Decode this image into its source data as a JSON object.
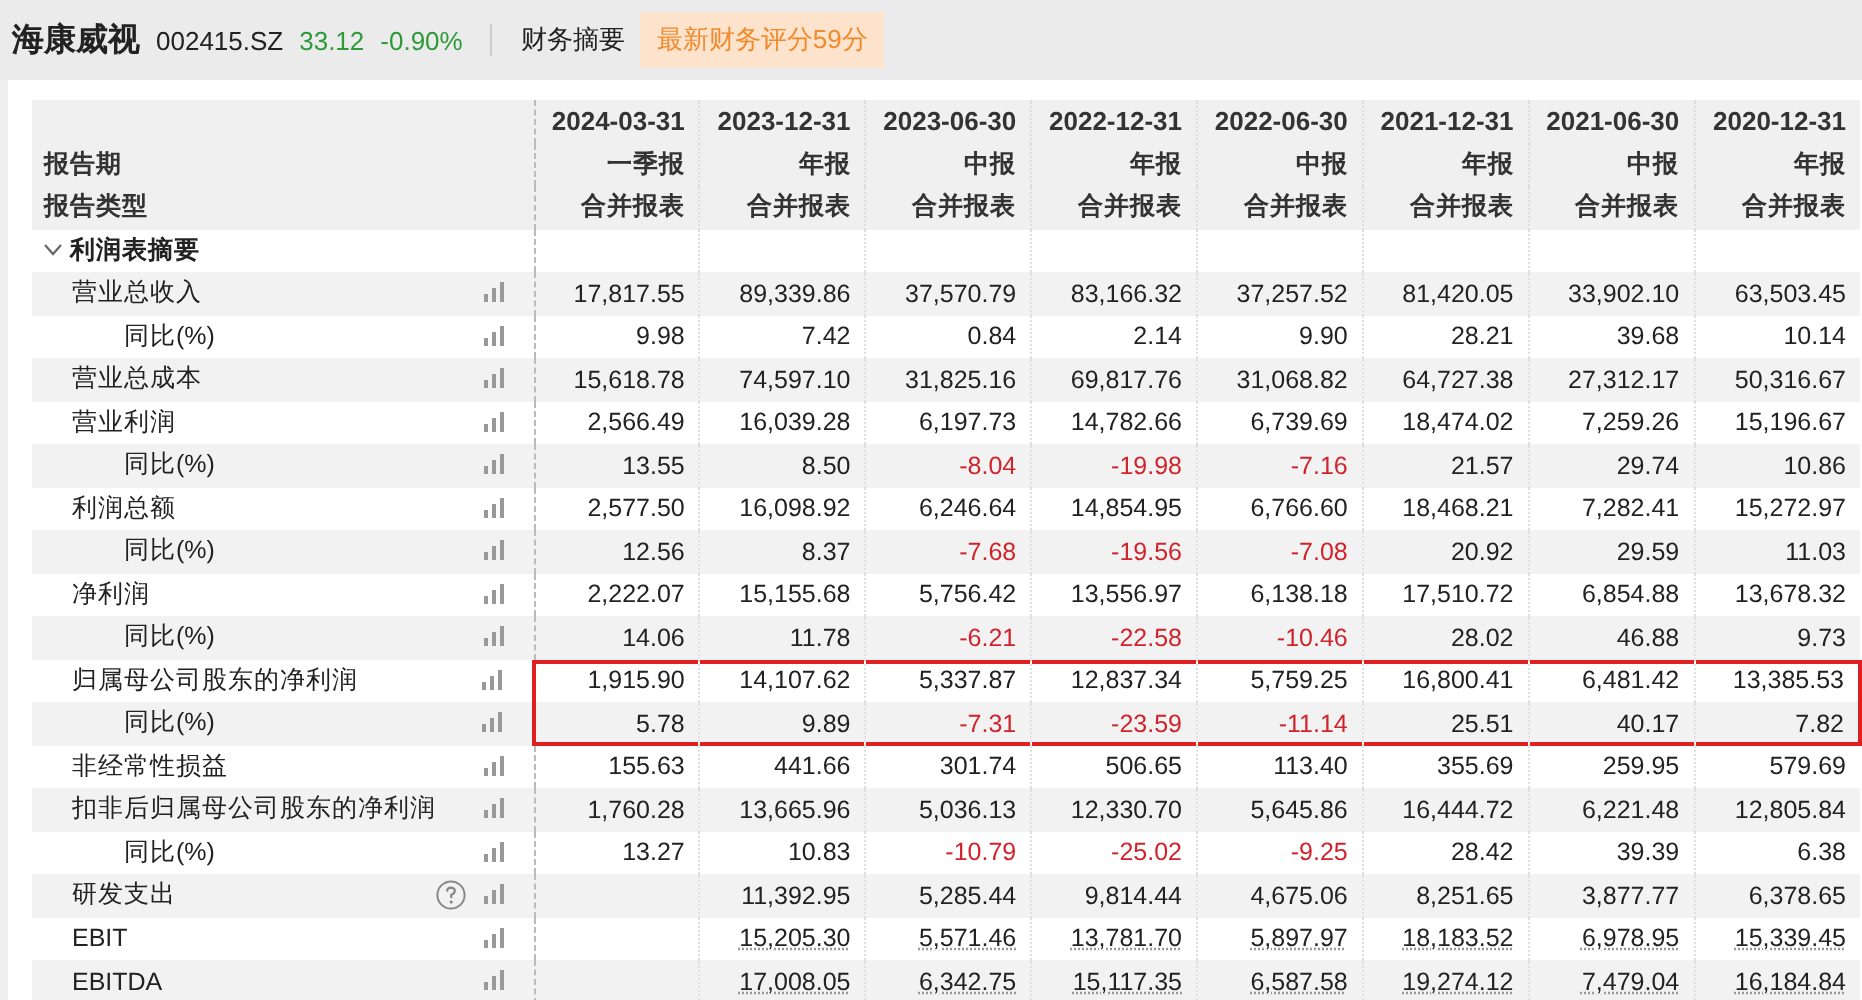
{
  "header": {
    "company": "海康威视",
    "code": "002415.SZ",
    "price": "33.12",
    "change": "-0.90%",
    "falling": true,
    "section": "财务摘要",
    "score_badge": "最新财务评分59分"
  },
  "table": {
    "period_label": "报告期",
    "type_label": "报告类型",
    "columns": [
      {
        "date": "2024-03-31",
        "period": "一季报",
        "type": "合并报表"
      },
      {
        "date": "2023-12-31",
        "period": "年报",
        "type": "合并报表"
      },
      {
        "date": "2023-06-30",
        "period": "中报",
        "type": "合并报表"
      },
      {
        "date": "2022-12-31",
        "period": "年报",
        "type": "合并报表"
      },
      {
        "date": "2022-06-30",
        "period": "中报",
        "type": "合并报表"
      },
      {
        "date": "2021-12-31",
        "period": "年报",
        "type": "合并报表"
      },
      {
        "date": "2021-06-30",
        "period": "中报",
        "type": "合并报表"
      },
      {
        "date": "2020-12-31",
        "period": "年报",
        "type": "合并报表"
      }
    ],
    "section": {
      "label": "利润表摘要",
      "expanded": true,
      "rows": [
        {
          "label": "营业总收入",
          "cells": [
            "17,817.55",
            "89,339.86",
            "37,570.79",
            "83,166.32",
            "37,257.52",
            "81,420.05",
            "33,902.10",
            "63,503.45"
          ],
          "children": [
            {
              "label": "同比(%)",
              "cells": [
                "9.98",
                "7.42",
                "0.84",
                "2.14",
                "9.90",
                "28.21",
                "39.68",
                "10.14"
              ]
            }
          ]
        },
        {
          "label": "营业总成本",
          "cells": [
            "15,618.78",
            "74,597.10",
            "31,825.16",
            "69,817.76",
            "31,068.82",
            "64,727.38",
            "27,312.17",
            "50,316.67"
          ]
        },
        {
          "label": "营业利润",
          "cells": [
            "2,566.49",
            "16,039.28",
            "6,197.73",
            "14,782.66",
            "6,739.69",
            "18,474.02",
            "7,259.26",
            "15,196.67"
          ],
          "children": [
            {
              "label": "同比(%)",
              "cells": [
                "13.55",
                "8.50",
                {
                  "text": "-8.04",
                  "negative": true
                },
                {
                  "text": "-19.98",
                  "negative": true
                },
                {
                  "text": "-7.16",
                  "negative": true
                },
                "21.57",
                "29.74",
                "10.86"
              ]
            }
          ]
        },
        {
          "label": "利润总额",
          "cells": [
            "2,577.50",
            "16,098.92",
            "6,246.64",
            "14,854.95",
            "6,766.60",
            "18,468.21",
            "7,282.41",
            "15,272.97"
          ],
          "children": [
            {
              "label": "同比(%)",
              "cells": [
                "12.56",
                "8.37",
                {
                  "text": "-7.68",
                  "negative": true
                },
                {
                  "text": "-19.56",
                  "negative": true
                },
                {
                  "text": "-7.08",
                  "negative": true
                },
                "20.92",
                "29.59",
                "11.03"
              ]
            }
          ]
        },
        {
          "label": "净利润",
          "cells": [
            "2,222.07",
            "15,155.68",
            "5,756.42",
            "13,556.97",
            "6,138.18",
            "17,510.72",
            "6,854.88",
            "13,678.32"
          ],
          "children": [
            {
              "label": "同比(%)",
              "cells": [
                "14.06",
                "11.78",
                {
                  "text": "-6.21",
                  "negative": true
                },
                {
                  "text": "-22.58",
                  "negative": true
                },
                {
                  "text": "-10.46",
                  "negative": true
                },
                "28.02",
                "46.88",
                "9.73"
              ]
            }
          ]
        },
        {
          "label": "归属母公司股东的净利润",
          "highlighted": true,
          "cells": [
            "1,915.90",
            "14,107.62",
            "5,337.87",
            "12,837.34",
            "5,759.25",
            "16,800.41",
            "6,481.42",
            "13,385.53"
          ],
          "children": [
            {
              "label": "同比(%)",
              "highlighted": true,
              "cells": [
                "5.78",
                "9.89",
                {
                  "text": "-7.31",
                  "negative": true
                },
                {
                  "text": "-23.59",
                  "negative": true
                },
                {
                  "text": "-11.14",
                  "negative": true
                },
                "25.51",
                "40.17",
                "7.82"
              ]
            }
          ]
        },
        {
          "label": "非经常性损益",
          "cells": [
            "155.63",
            "441.66",
            "301.74",
            "506.65",
            "113.40",
            "355.69",
            "259.95",
            "579.69"
          ]
        },
        {
          "label": "扣非后归属母公司股东的净利润",
          "cells": [
            "1,760.28",
            "13,665.96",
            "5,036.13",
            "12,330.70",
            "5,645.86",
            "16,444.72",
            "6,221.48",
            "12,805.84"
          ],
          "children": [
            {
              "label": "同比(%)",
              "cells": [
                "13.27",
                "10.83",
                {
                  "text": "-10.79",
                  "negative": true
                },
                {
                  "text": "-25.02",
                  "negative": true
                },
                {
                  "text": "-9.25",
                  "negative": true
                },
                "28.42",
                "39.39",
                "6.38"
              ]
            }
          ]
        },
        {
          "label": "研发支出",
          "help": true,
          "cells": [
            null,
            "11,392.95",
            "5,285.44",
            "9,814.44",
            "4,675.06",
            "8,251.65",
            "3,877.77",
            "6,378.65"
          ]
        },
        {
          "label": "EBIT",
          "linked": true,
          "cells": [
            null,
            "15,205.30",
            "5,571.46",
            "13,781.70",
            "5,897.97",
            "18,183.52",
            "6,978.95",
            "15,339.45"
          ]
        },
        {
          "label": "EBITDA",
          "linked": true,
          "cells": [
            null,
            "17,008.05",
            "6,342.75",
            "15,117.35",
            "6,587.58",
            "19,274.12",
            "7,479.04",
            "16,184.84"
          ]
        }
      ]
    }
  }
}
